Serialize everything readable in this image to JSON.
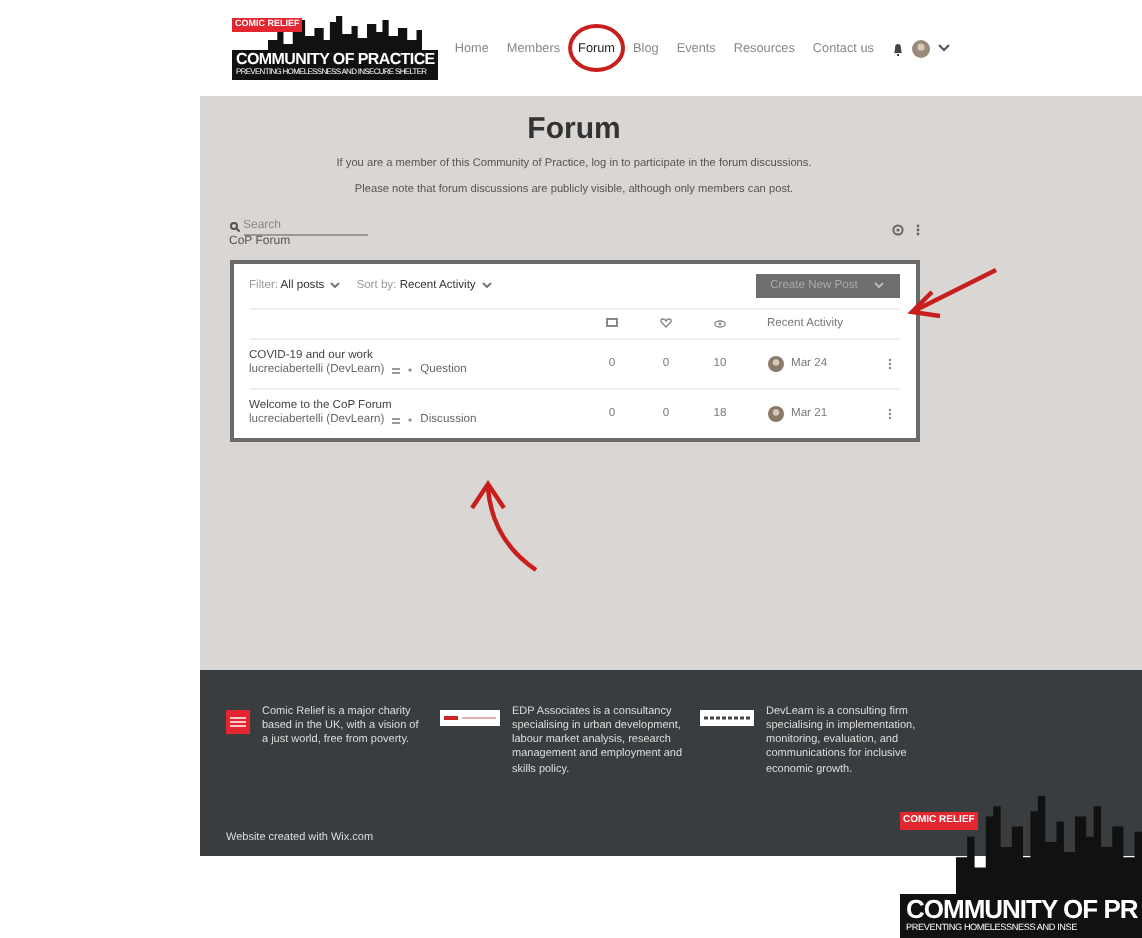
{
  "header": {
    "logo": {
      "badge": "COMIC RELIEF",
      "title": "COMMUNITY OF PRACTICE",
      "subtitle": "PREVENTING HOMELESSNESS AND INSECURE SHELTER"
    },
    "nav": [
      {
        "label": "Home",
        "selected": false
      },
      {
        "label": "Members",
        "selected": false
      },
      {
        "label": "Forum",
        "selected": true
      },
      {
        "label": "Blog",
        "selected": false
      },
      {
        "label": "Events",
        "selected": false
      },
      {
        "label": "Resources",
        "selected": false
      },
      {
        "label": "Contact us",
        "selected": false
      }
    ]
  },
  "forum": {
    "title": "Forum",
    "intro": [
      "If you are a member of this Community of Practice, log in to participate in the forum discussions.",
      "Please note that forum discussions are publicly visible, although only members can post."
    ],
    "search": {
      "placeholder": "Search"
    },
    "breadcrumb": "CoP Forum",
    "filter_label": "Filter:",
    "filter_value": "All posts",
    "sort_label": "Sort by:",
    "sort_value": "Recent Activity",
    "create_button": "Create New Post",
    "columns": {
      "column_4": "Recent Activity"
    },
    "posts": [
      {
        "title": "COVID-19 and our work",
        "author": "lucreciabertelli (DevLearn)",
        "category": "Question",
        "comments": "0",
        "likes": "0",
        "views": "10",
        "date": "Mar 24"
      },
      {
        "title": "Welcome to the CoP Forum",
        "author": "lucreciabertelli (DevLearn)",
        "category": "Discussion",
        "comments": "0",
        "likes": "0",
        "views": "18",
        "date": "Mar 21"
      }
    ]
  },
  "footer": {
    "partners": [
      {
        "text": "Comic Relief is a major charity based in the UK, with a vision of a just world, free from poverty."
      },
      {
        "text": "EDP Associates is a consultancy specialising in urban development, labour market analysis, research management and employment and skills policy."
      },
      {
        "text": "DevLearn is a consulting firm specialising in implementation, monitoring, evaluation, and communications for inclusive economic growth."
      }
    ],
    "credit": "Website created with Wix.com"
  },
  "bottom_logo": {
    "badge": "COMIC RELIEF",
    "title": "COMMUNITY OF PR",
    "subtitle": "PREVENTING HOMELESSNESS AND INSE"
  }
}
